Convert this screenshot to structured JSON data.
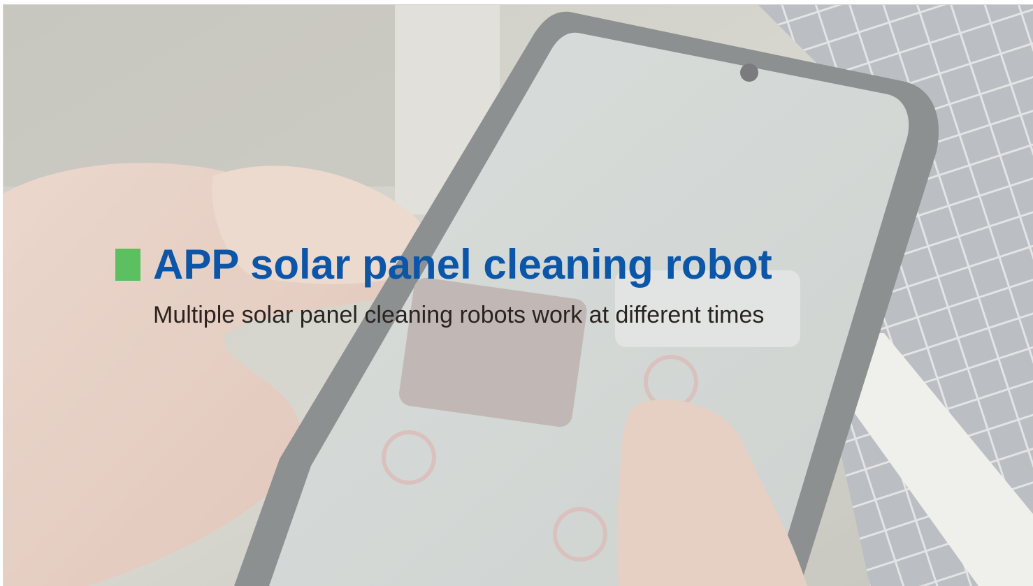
{
  "slide": {
    "title": "APP solar panel cleaning robot",
    "subtitle": "Multiple solar panel cleaning robots work at different times"
  },
  "colors": {
    "title": "#0b56a8",
    "subtitle": "#2a2320",
    "marker": "#5cc060"
  },
  "icons": {
    "title_marker": "green-square-bullet-icon"
  }
}
